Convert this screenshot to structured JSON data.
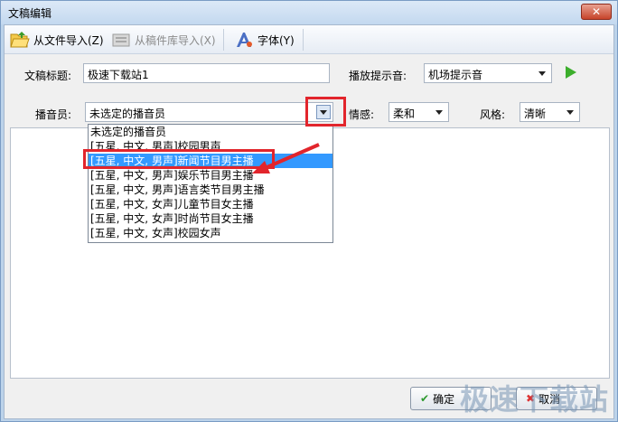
{
  "window": {
    "title": "文稿编辑",
    "close_label": "✕"
  },
  "toolbar": {
    "import_file": "从文件导入(Z)",
    "import_library": "从稿件库导入(X)",
    "font": "字体(Y)"
  },
  "form": {
    "title_label": "文稿标题:",
    "title_value": "极速下载站1",
    "prompt_label": "播放提示音:",
    "prompt_value": "机场提示音",
    "announcer_label": "播音员:",
    "announcer_value": "未选定的播音员",
    "emotion_label": "情感:",
    "emotion_value": "柔和",
    "style_label": "风格:",
    "style_value": "清晰"
  },
  "announcer_options": [
    "未选定的播音员",
    "[五星, 中文, 男声]校园男声",
    "[五星, 中文, 男声]新闻节目男主播",
    "[五星, 中文, 男声]娱乐节目男主播",
    "[五星, 中文, 男声]语言类节目男主播",
    "[五星, 中文, 女声]儿童节目女主播",
    "[五星, 中文, 女声]时尚节目女主播",
    "[五星, 中文, 女声]校园女声"
  ],
  "selected_option_index": 2,
  "footer": {
    "ok": "确定",
    "cancel": "取消"
  },
  "watermark": "极速下载站",
  "colors": {
    "selection": "#3399ff",
    "highlight": "#e2252c",
    "play": "#3cae2c"
  }
}
